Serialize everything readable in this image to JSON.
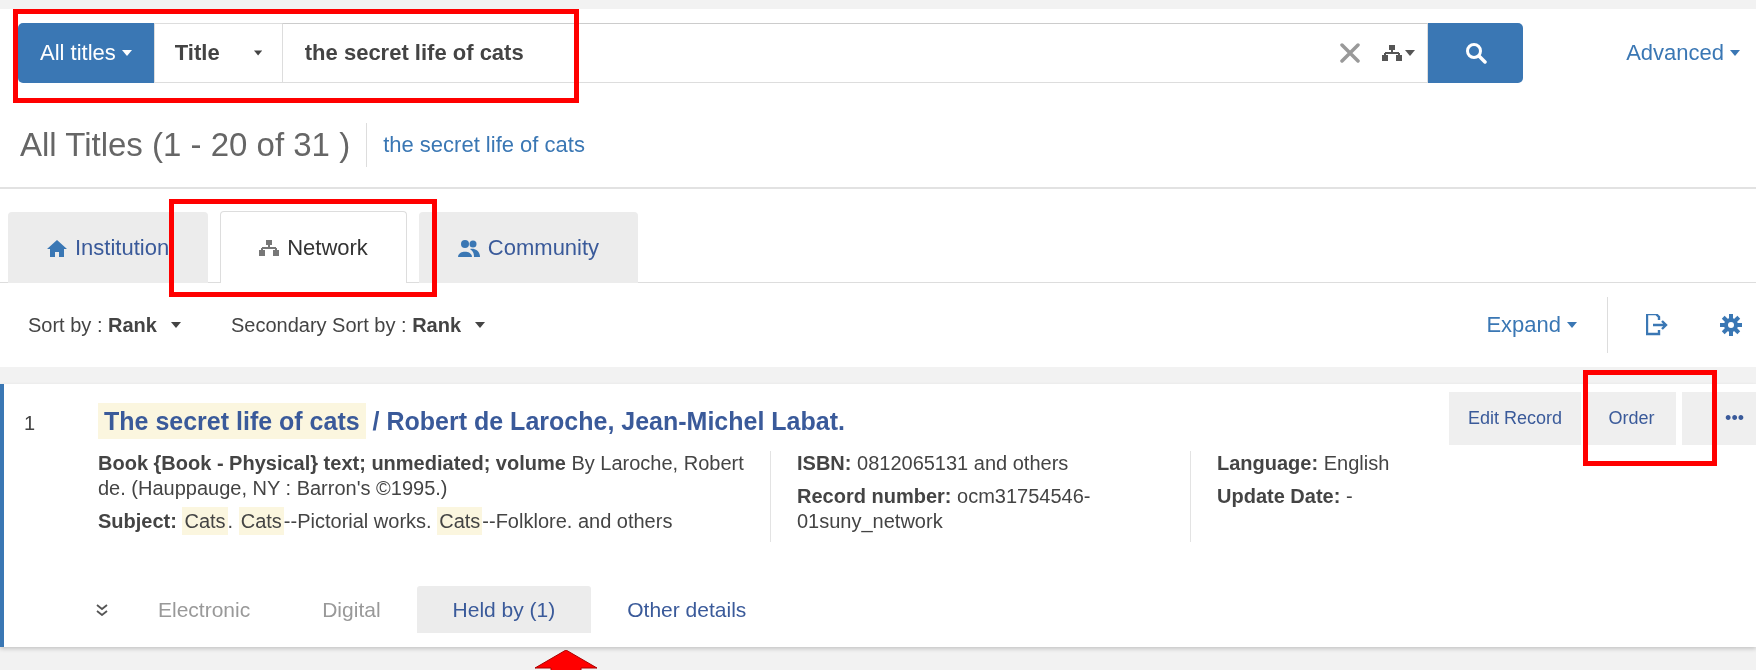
{
  "search": {
    "scope": "All titles",
    "field": "Title",
    "value": "the secret life of cats",
    "advanced": "Advanced"
  },
  "results": {
    "heading": "All Titles (1 - 20 of 31 )",
    "query_link": "the secret life of cats"
  },
  "scope_tabs": [
    {
      "label": "Institution",
      "selected": false
    },
    {
      "label": "Network",
      "selected": true
    },
    {
      "label": "Community",
      "selected": false
    }
  ],
  "sort": [
    {
      "label": "Sort by :",
      "value": "Rank"
    },
    {
      "label": "Secondary Sort by :",
      "value": "Rank"
    }
  ],
  "toolbar": {
    "expand": "Expand"
  },
  "records": [
    {
      "number": "1",
      "title": [
        {
          "text": "The secret life of cats",
          "highlighted": true
        },
        {
          "text": "/ Robert de Laroche, Jean-Michel Labat.",
          "highlighted": false
        }
      ],
      "actions": [
        "Edit Record",
        "Order",
        "•••"
      ],
      "description": "**Book {Book - Physical} text; unmediated; volume** By Laroche, Robert de. (Hauppauge, NY : Barron's ©1995.)",
      "subject": {
        "label": "Subject:",
        "parts": [
          {
            "text": "Cats",
            "highlighted": true
          },
          {
            "text": ". ",
            "highlighted": false
          },
          {
            "text": "Cats",
            "highlighted": true
          },
          {
            "text": "--Pictorial works. ",
            "highlighted": false
          },
          {
            "text": "Cats",
            "highlighted": true
          },
          {
            "text": "--Folklore. and others",
            "highlighted": false
          }
        ]
      },
      "fields": [
        {
          "label": "ISBN:",
          "value": "0812065131 and others"
        },
        {
          "label": "Record number:",
          "value": "ocm31754546-01suny_network"
        },
        {
          "label": "Language:",
          "value": "English"
        },
        {
          "label": "Update Date:",
          "value": "-"
        }
      ],
      "tabs": [
        {
          "label": "Electronic",
          "selected": false,
          "disabled": true
        },
        {
          "label": "Digital",
          "selected": false,
          "disabled": true
        },
        {
          "label": "Held by (1)",
          "selected": true,
          "disabled": false
        },
        {
          "label": "Other details",
          "selected": false,
          "disabled": false
        }
      ]
    }
  ],
  "annotations": [
    {
      "kind": "frame"
    },
    {
      "kind": "frame"
    },
    {
      "kind": "frame"
    },
    {
      "kind": "arrow"
    }
  ]
}
